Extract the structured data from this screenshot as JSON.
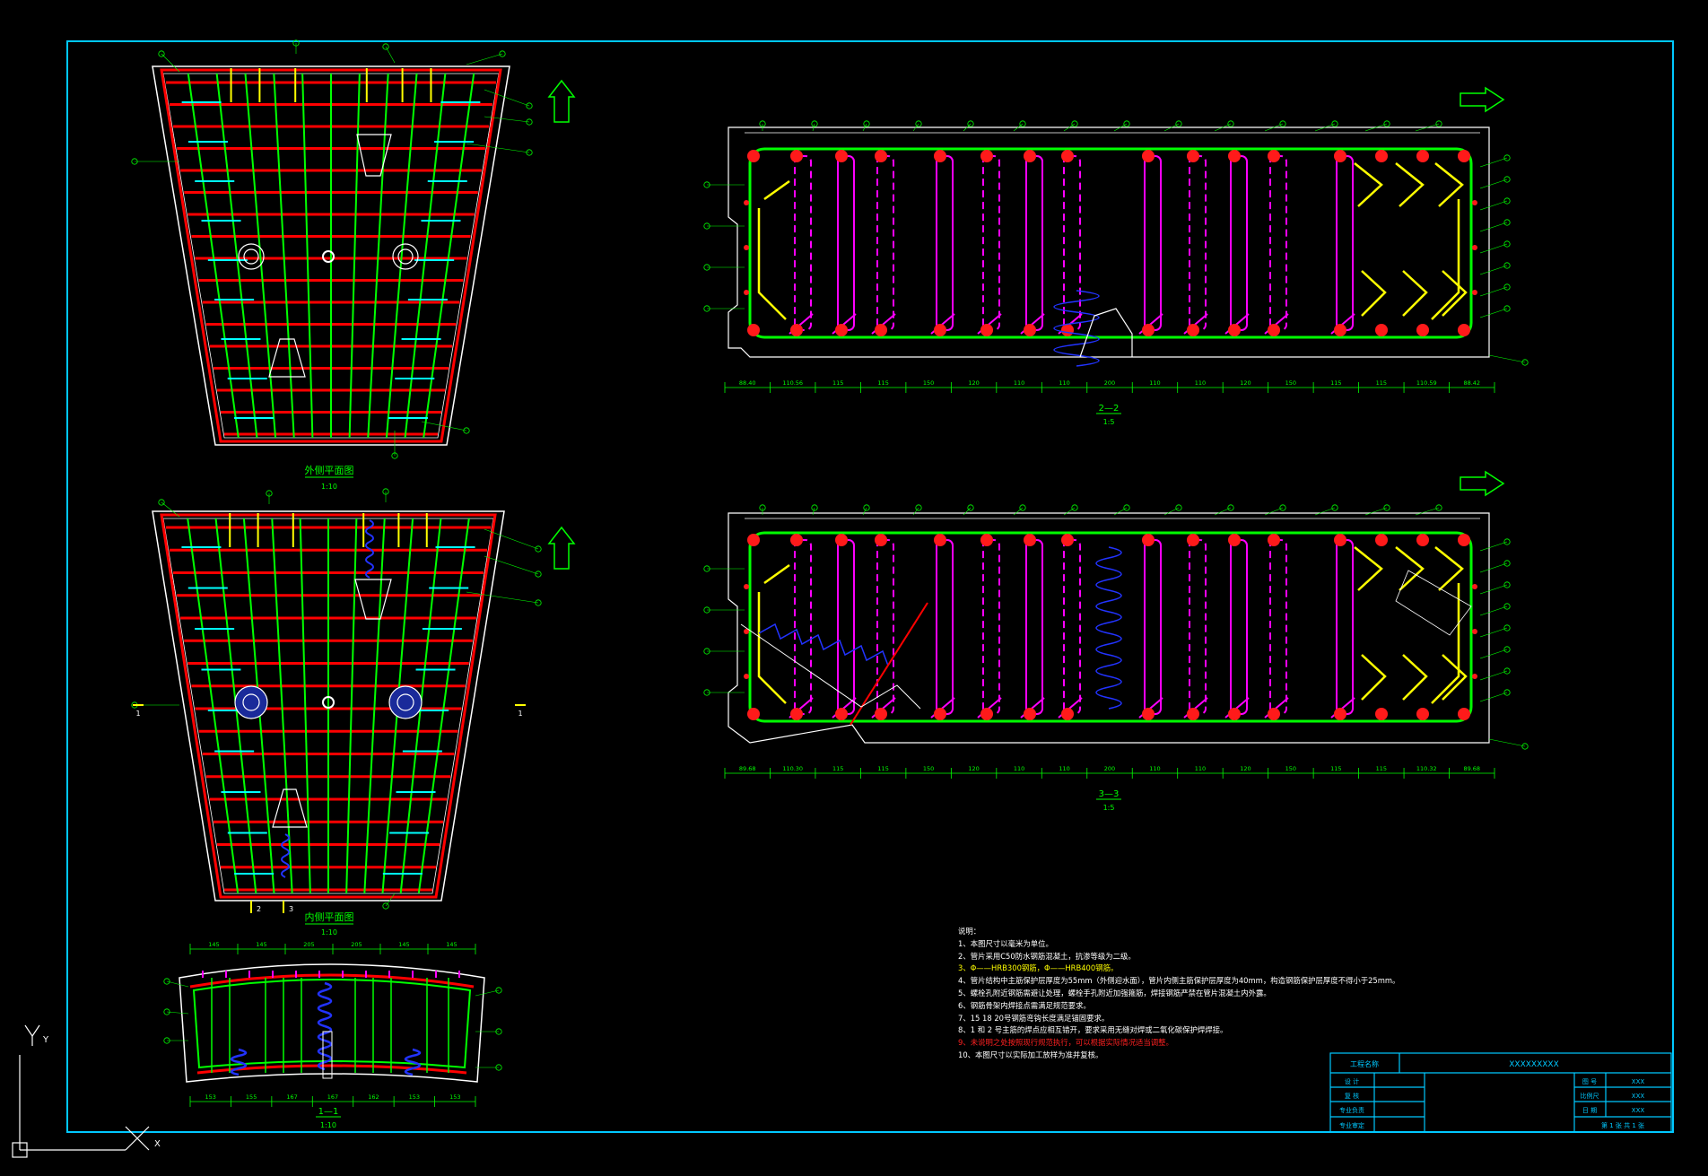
{
  "view_titles": {
    "outer_plan": "外侧平面图",
    "inner_plan": "内侧平面图",
    "section_11": "1—1",
    "section_22": "2—2",
    "section_33": "3—3"
  },
  "scales": {
    "outer_plan": "1:10",
    "inner_plan": "1:10",
    "section_11": "1:10",
    "section_22": "1:5",
    "section_33": "1:5"
  },
  "section_markers": {
    "left_2": "2",
    "left_3": "3",
    "right_1": "1",
    "left_1": "1"
  },
  "dimensions_22": [
    "88.40",
    "110.56",
    "115",
    "115",
    "150",
    "120",
    "110",
    "110",
    "200",
    "110",
    "110",
    "120",
    "150",
    "115",
    "115",
    "110.59",
    "88.42"
  ],
  "dimensions_33": [
    "89.68",
    "110.30",
    "115",
    "115",
    "150",
    "120",
    "110",
    "110",
    "200",
    "110",
    "110",
    "120",
    "150",
    "115",
    "115",
    "110.32",
    "89.68"
  ],
  "dimensions_11_top": [
    "145",
    "145",
    "205",
    "205",
    "145",
    "145"
  ],
  "dimensions_11_bottom": [
    "153",
    "155",
    "167",
    "167",
    "162",
    "153",
    "153"
  ],
  "notes": {
    "title": "说明：",
    "items": [
      "1、本图尺寸以毫米为单位。",
      "2、管片采用C50防水钢筋混凝土，抗渗等级为二级。",
      "3、Φ——HRB300钢筋，Φ——HRB400钢筋。",
      "4、管片结构中主筋保护层厚度为55mm（外侧迎水面），管片内侧主筋保护层厚度为40mm，构造钢筋保护层厚度不得小于25mm。",
      "5、螺栓孔附近钢筋需避让处理，螺栓手孔附近加强箍筋，焊接钢筋严禁在管片混凝土内外露。",
      "6、钢筋骨架内焊接点需满足规范要求。",
      "7、15 18 20号钢筋弯钩长度满足锚固要求。",
      "8、1 和 2 号主筋的焊点应相互错开，要求采用无缝对焊或二氧化碳保护焊焊接。",
      "9、未说明之处按照现行规范执行，可以根据实际情况适当调整。",
      "10、本图尺寸以实际加工放样为准并复核。"
    ]
  },
  "title_block": {
    "project_label": "工程名称",
    "project_value": "XXXXXXXXX",
    "rows_left": [
      "设 计",
      "复 核",
      "专业负责",
      "专业审定"
    ],
    "drawing_no_label": "图 号",
    "drawing_no_value": "XXX",
    "scale_label": "比例尺",
    "scale_value": "XXX",
    "date_label": "日 期",
    "date_value": "XXX",
    "sheet_text": "第 1 张  共 1 张"
  },
  "ucs": {
    "y_label": "Y",
    "x_label": "X"
  },
  "colors": {
    "frame": "#00c8ff",
    "outline": "#ffffff",
    "main_rebar": "#ff0000",
    "stirrup": "#00ff00",
    "hoop": "#ff00ff",
    "tie": "#ffff00",
    "spiral": "#2233ff",
    "dist": "#00ffff"
  }
}
